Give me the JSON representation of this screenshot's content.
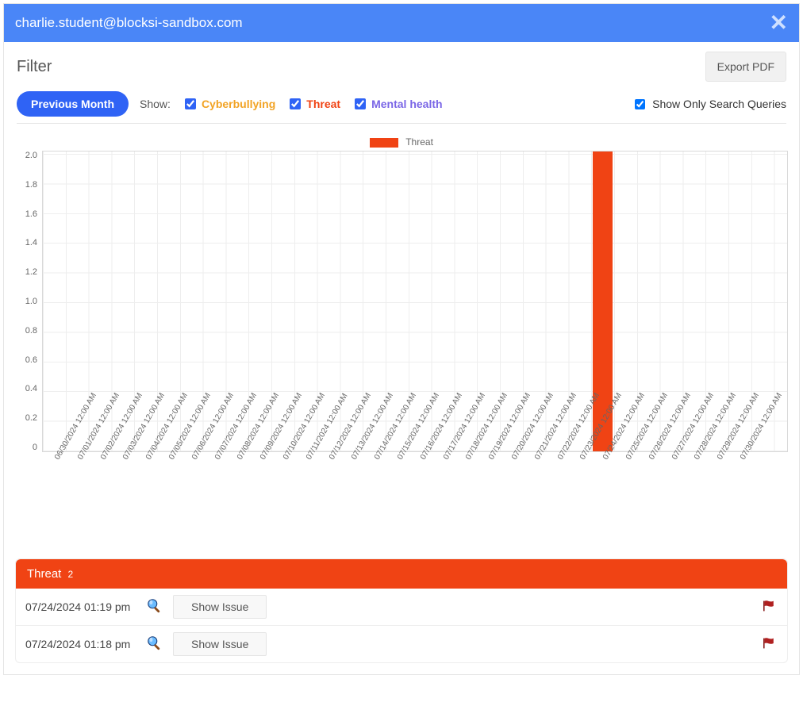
{
  "header": {
    "email": "charlie.student@blocksi-sandbox.com"
  },
  "panel": {
    "title": "Filter",
    "export_btn": "Export PDF",
    "prev_btn": "Previous Month",
    "show_label": "Show:",
    "cb": {
      "cyberbullying": "Cyberbullying",
      "threat": "Threat",
      "mental": "Mental health",
      "search_only": "Show Only Search Queries"
    }
  },
  "chart_data": {
    "type": "bar",
    "legend": "Threat",
    "ylim": [
      0,
      2.0
    ],
    "yticks": [
      "2.0",
      "1.8",
      "1.6",
      "1.4",
      "1.2",
      "1.0",
      "0.8",
      "0.6",
      "0.4",
      "0.2",
      "0"
    ],
    "categories": [
      "06/30/2024 12:00 AM",
      "07/01/2024 12:00 AM",
      "07/02/2024 12:00 AM",
      "07/03/2024 12:00 AM",
      "07/04/2024 12:00 AM",
      "07/05/2024 12:00 AM",
      "07/06/2024 12:00 AM",
      "07/07/2024 12:00 AM",
      "07/08/2024 12:00 AM",
      "07/09/2024 12:00 AM",
      "07/10/2024 12:00 AM",
      "07/11/2024 12:00 AM",
      "07/12/2024 12:00 AM",
      "07/13/2024 12:00 AM",
      "07/14/2024 12:00 AM",
      "07/15/2024 12:00 AM",
      "07/16/2024 12:00 AM",
      "07/17/2024 12:00 AM",
      "07/18/2024 12:00 AM",
      "07/19/2024 12:00 AM",
      "07/20/2024 12:00 AM",
      "07/21/2024 12:00 AM",
      "07/22/2024 12:00 AM",
      "07/23/2024 12:00 AM",
      "07/24/2024 12:00 AM",
      "07/25/2024 12:00 AM",
      "07/26/2024 12:00 AM",
      "07/27/2024 12:00 AM",
      "07/28/2024 12:00 AM",
      "07/29/2024 12:00 AM",
      "07/30/2024 12:00 AM"
    ],
    "series": [
      {
        "name": "Threat",
        "color": "#f04314",
        "values": [
          0,
          0,
          0,
          0,
          0,
          0,
          0,
          0,
          0,
          0,
          0,
          0,
          0,
          0,
          0,
          0,
          0,
          0,
          0,
          0,
          0,
          0,
          0,
          0,
          2,
          0,
          0,
          0,
          0,
          0,
          0
        ]
      }
    ]
  },
  "threat_section": {
    "title": "Threat",
    "count": "2",
    "show_issue_btn": "Show Issue",
    "rows": [
      {
        "ts": "07/24/2024 01:19 pm"
      },
      {
        "ts": "07/24/2024 01:18 pm"
      }
    ]
  }
}
